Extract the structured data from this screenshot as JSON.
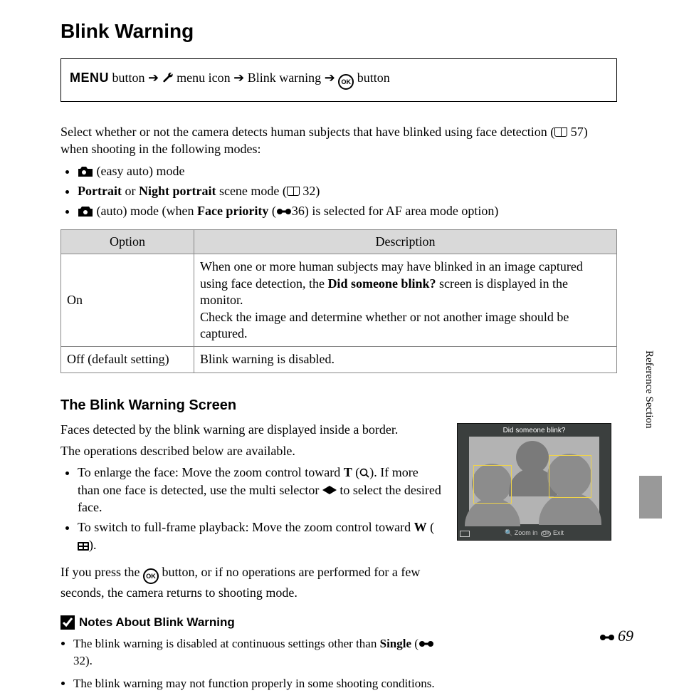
{
  "heading": "Blink Warning",
  "nav": {
    "menu_button": "MENU",
    "button_word": "button",
    "menu_icon_label": "menu icon",
    "item": "Blink warning",
    "ok_button_label": "button"
  },
  "intro": {
    "line1_a": "Select whether or not the camera detects human subjects that have blinked using face detection (",
    "line1_b": " 57) when shooting in the following modes:",
    "bullets": [
      {
        "pre_icon": true,
        "text": " (easy auto) mode"
      },
      {
        "rich": true,
        "b1": "Portrait",
        "mid": " or ",
        "b2": "Night portrait",
        "after": " scene mode (",
        "ref": " 32)"
      },
      {
        "auto": true,
        "t1": " (auto) mode (when ",
        "b": "Face priority",
        "t2": " (",
        "ref": "36",
        "t3": ") is selected for AF area mode option)"
      }
    ]
  },
  "table": {
    "h1": "Option",
    "h2": "Description",
    "rows": [
      {
        "option": "On",
        "desc_a": "When one or more human subjects may have blinked in an image captured using face detection, the ",
        "desc_b": "Did someone blink?",
        "desc_c": " screen is displayed in the monitor.",
        "desc_d": "Check the image and determine whether or not another image should be captured."
      },
      {
        "option": "Off (default setting)",
        "desc": "Blink warning is disabled."
      }
    ]
  },
  "subheading": "The Blink Warning Screen",
  "screen": {
    "p1": "Faces detected by the blink warning are displayed inside a border.",
    "p2": "The operations described below are available.",
    "li1_a": "To enlarge the face: Move the zoom control toward ",
    "li1_T": "T",
    "li1_b": " (",
    "li1_c": "). If more than one face is detected, use the multi selector ",
    "li1_d": " to select the desired face.",
    "li2_a": "To switch to full-frame playback: Move the zoom control toward ",
    "li2_W": "W",
    "li2_b": " (",
    "li2_c": ").",
    "p3_a": "If you press the ",
    "p3_b": " button, or if no operations are performed for a few seconds, the camera returns to shooting mode."
  },
  "camshot": {
    "title": "Did someone blink?",
    "footer_zoom": "Zoom in",
    "footer_exit": "Exit"
  },
  "notes": {
    "title": "Notes About Blink Warning",
    "items": [
      {
        "a": "The blink warning is disabled at continuous settings other than ",
        "b": "Single",
        "c": " (",
        "ref": "32",
        "d": ")."
      },
      {
        "a": "The blink warning may not function properly in some shooting conditions."
      }
    ]
  },
  "sidebar": "Reference Section",
  "page_number": "69"
}
